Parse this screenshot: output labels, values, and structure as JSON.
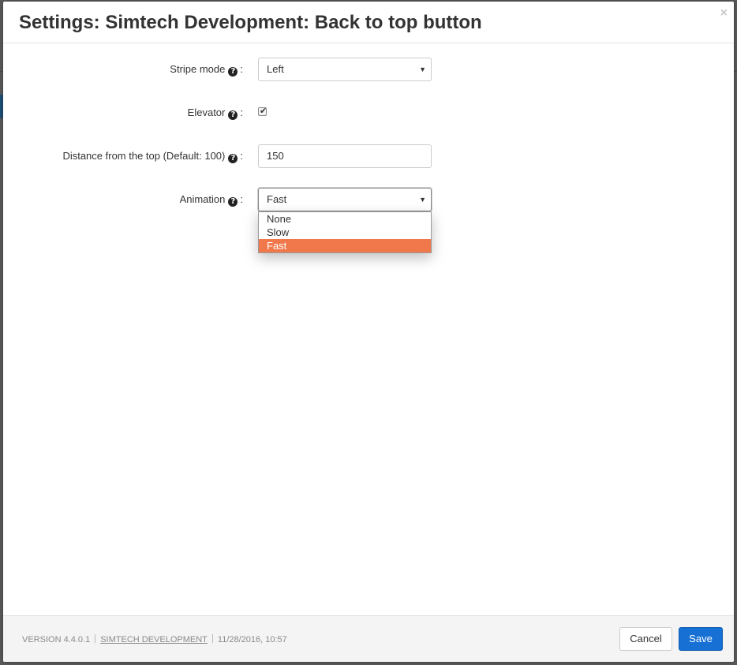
{
  "modal": {
    "title": "Settings: Simtech Development: Back to top button",
    "close_symbol": "×"
  },
  "form": {
    "stripe_mode": {
      "label": "Stripe mode",
      "value": "Left"
    },
    "elevator": {
      "label": "Elevator",
      "checked": true,
      "check_symbol": "✔"
    },
    "distance": {
      "label": "Distance from the top (Default: 100)",
      "value": "150"
    },
    "animation": {
      "label": "Animation",
      "value": "Fast",
      "options": [
        "None",
        "Slow",
        "Fast"
      ],
      "highlighted_option": "Fast"
    },
    "help_symbol": "?",
    "colon": ":"
  },
  "footer": {
    "version": "VERSION 4.4.0.1",
    "vendor_link": "SIMTECH DEVELOPMENT",
    "date": "11/28/2016, 10:57",
    "cancel_label": "Cancel",
    "save_label": "Save"
  },
  "colors": {
    "highlight": "#f0784a",
    "save_button": "#1770d4",
    "help_icon": "#222222"
  },
  "icons": {
    "close": "close-icon",
    "help": "question-circle-icon",
    "select_arrow": "caret-down-icon",
    "checkbox": "checkmark-icon"
  }
}
